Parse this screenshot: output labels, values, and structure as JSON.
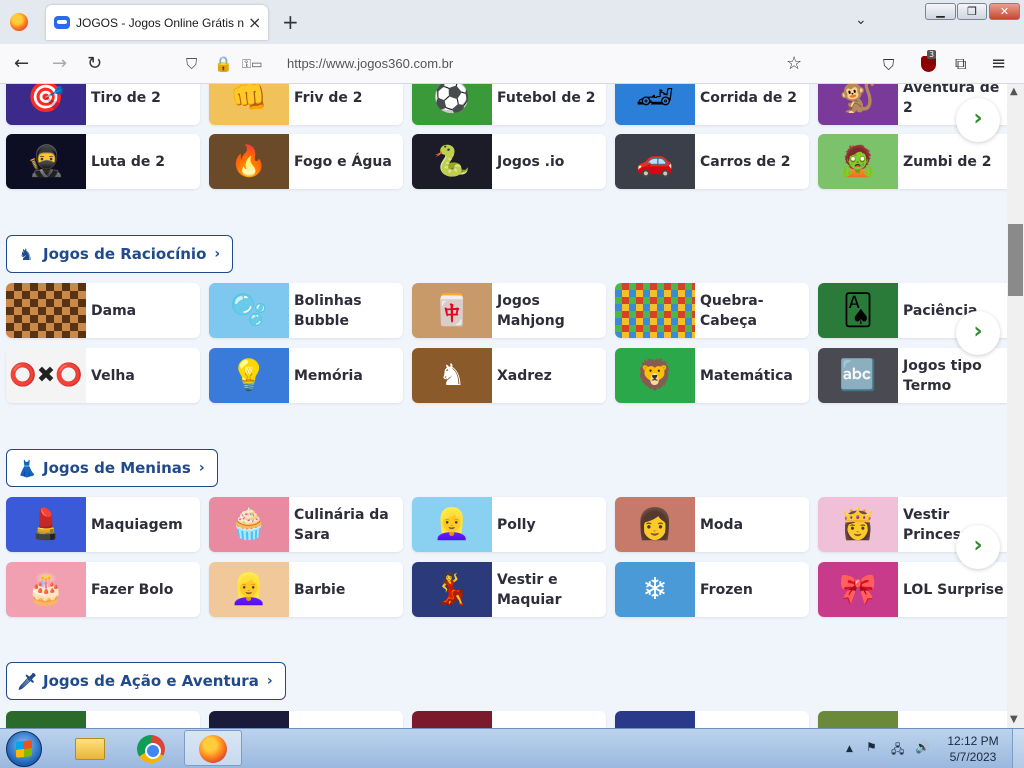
{
  "browser": {
    "tab_title": "JOGOS - Jogos Online Grátis no",
    "url": "https://www.jogos360.com.br",
    "ublock_count": "3",
    "window_buttons": [
      "▁",
      "❐",
      "✕"
    ]
  },
  "sections": [
    {
      "title": "",
      "rows": [
        [
          {
            "label": "Tiro de 2",
            "color": "#3b2a8a",
            "icon": "🎯"
          },
          {
            "label": "Friv de 2",
            "color": "#f2c25a",
            "icon": "👊"
          },
          {
            "label": "Futebol de 2",
            "color": "#3a9a3a",
            "icon": "⚽"
          },
          {
            "label": "Corrida de 2",
            "color": "#2b7fd8",
            "icon": "🏎"
          },
          {
            "label": "Aventura de 2",
            "color": "#7a3a9a",
            "icon": "🐒"
          }
        ],
        [
          {
            "label": "Luta de 2",
            "color": "#0d0d24",
            "icon": "🥷"
          },
          {
            "label": "Fogo e Água",
            "color": "#6b4a2a",
            "icon": "🔥"
          },
          {
            "label": "Jogos .io",
            "color": "#1c1c28",
            "icon": "🐍"
          },
          {
            "label": "Carros de 2",
            "color": "#3a3f4a",
            "icon": "🚗"
          },
          {
            "label": "Zumbi de 2",
            "color": "#7bc26a",
            "icon": "🧟"
          }
        ]
      ]
    },
    {
      "title": "Jogos de Raciocínio",
      "icon": "♞",
      "rows": [
        [
          {
            "label": "Dama",
            "color": "#7a4a22",
            "icon": "⬛"
          },
          {
            "label": "Bolinhas Bubble",
            "color": "#7ec8f0",
            "icon": "🫧"
          },
          {
            "label": "Jogos Mahjong",
            "color": "#c89a6a",
            "icon": "🀄"
          },
          {
            "label": "Quebra-Cabeça",
            "color": "#d8402a",
            "icon": "🧩"
          },
          {
            "label": "Paciência",
            "color": "#2a7a3a",
            "icon": "🂡"
          }
        ],
        [
          {
            "label": "Velha",
            "color": "#f4f4f4",
            "icon": "⭕"
          },
          {
            "label": "Memória",
            "color": "#3a7ad8",
            "icon": "💡"
          },
          {
            "label": "Xadrez",
            "color": "#8a5a2a",
            "icon": "♞"
          },
          {
            "label": "Matemática",
            "color": "#2aa84a",
            "icon": "🦁"
          },
          {
            "label": "Jogos tipo Termo",
            "color": "#4a4a52",
            "icon": "🔤"
          }
        ]
      ]
    },
    {
      "title": "Jogos de Meninas",
      "icon": "👗",
      "rows": [
        [
          {
            "label": "Maquiagem",
            "color": "#3a5ad8",
            "icon": "💄"
          },
          {
            "label": "Culinária da Sara",
            "color": "#e88aa0",
            "icon": "🧁"
          },
          {
            "label": "Polly",
            "color": "#8ad0f0",
            "icon": "👱‍♀️"
          },
          {
            "label": "Moda",
            "color": "#c87a6a",
            "icon": "👩"
          },
          {
            "label": "Vestir Princesas",
            "color": "#f0c0d8",
            "icon": "👸"
          }
        ],
        [
          {
            "label": "Fazer Bolo",
            "color": "#f0a0b0",
            "icon": "🎂"
          },
          {
            "label": "Barbie",
            "color": "#f0c89a",
            "icon": "👱‍♀️"
          },
          {
            "label": "Vestir e Maquiar",
            "color": "#2a3a7a",
            "icon": "💃"
          },
          {
            "label": "Frozen",
            "color": "#4a9ad8",
            "icon": "❄"
          },
          {
            "label": "LOL Surprise",
            "color": "#c83a8a",
            "icon": "🎀"
          }
        ]
      ]
    },
    {
      "title": "Jogos de Ação e Aventura",
      "icon": "🗡",
      "rows": [
        [
          {
            "label": "",
            "color": "#2a6a2a",
            "icon": ""
          },
          {
            "label": "",
            "color": "#1a1a3a",
            "icon": ""
          },
          {
            "label": "",
            "color": "#7a1a2a",
            "icon": ""
          },
          {
            "label": "",
            "color": "#2a3a8a",
            "icon": ""
          },
          {
            "label": "",
            "color": "#6a8a3a",
            "icon": ""
          }
        ]
      ]
    }
  ],
  "taskbar": {
    "time": "12:12 PM",
    "date": "5/7/2023"
  }
}
